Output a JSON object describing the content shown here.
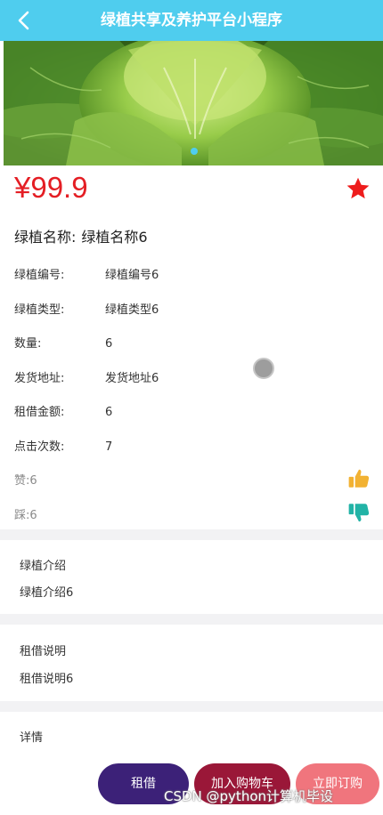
{
  "header": {
    "title": "绿植共享及养护平台小程序"
  },
  "product": {
    "price": "¥99.9",
    "name_label": "绿植名称:",
    "name_value": "绿植名称6",
    "fields": [
      {
        "label": "绿植编号:",
        "value": "绿植编号6"
      },
      {
        "label": "绿植类型:",
        "value": "绿植类型6"
      },
      {
        "label": "数量:",
        "value": "6"
      },
      {
        "label": "发货地址:",
        "value": "发货地址6"
      },
      {
        "label": "租借金额:",
        "value": "6"
      },
      {
        "label": "点击次数:",
        "value": "7"
      }
    ],
    "likes": "赞:6",
    "dislikes": "踩:6"
  },
  "sections": [
    {
      "title": "绿植介绍",
      "text": "绿植介绍6"
    },
    {
      "title": "租借说明",
      "text": "租借说明6"
    },
    {
      "title": "详情",
      "text": ""
    }
  ],
  "actions": {
    "rent": "租借",
    "cart": "加入购物车",
    "buy": "立即订购"
  },
  "watermark": "CSDN @python计算机毕设",
  "colors": {
    "header": "#4fcdee",
    "price": "#e41e24",
    "rent": "#3c2178",
    "cart": "#9a1738",
    "buy": "#f0757d"
  },
  "icons": {
    "back": "chevron-left-icon",
    "favorite": "star-icon",
    "like": "thumbs-up-icon",
    "dislike": "thumbs-down-icon"
  }
}
